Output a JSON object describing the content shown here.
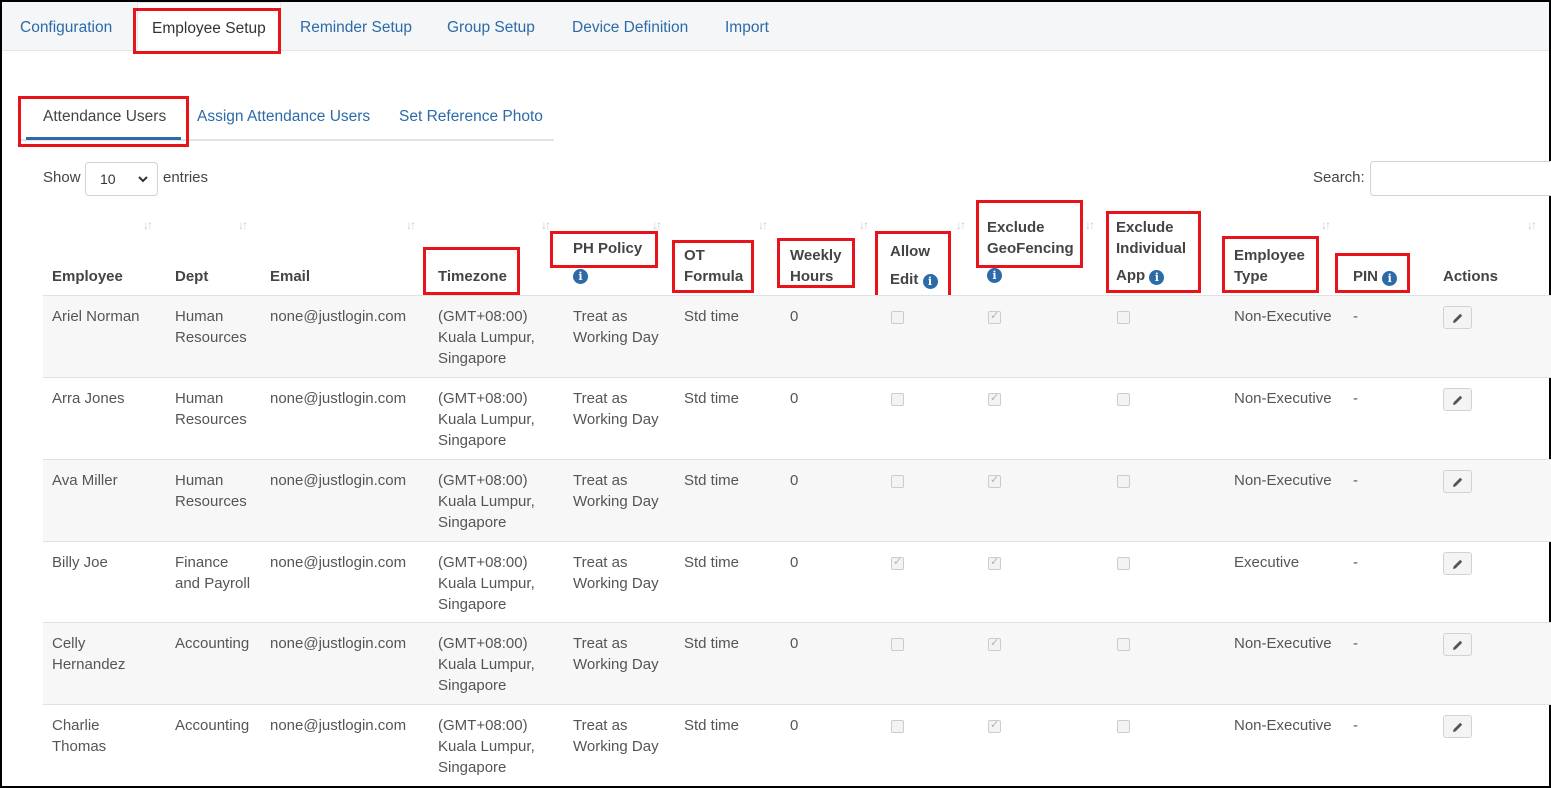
{
  "top_nav": {
    "tabs": [
      "Configuration",
      "Employee Setup",
      "Reminder Setup",
      "Group Setup",
      "Device Definition",
      "Import"
    ],
    "active": "Employee Setup"
  },
  "sub_nav": {
    "tabs": [
      "Attendance Users",
      "Assign Attendance Users",
      "Set Reference Photo"
    ],
    "active": "Attendance Users"
  },
  "length_control": {
    "show_label": "Show",
    "value": "10",
    "entries_label": "entries"
  },
  "search": {
    "label": "Search:",
    "value": ""
  },
  "table": {
    "headers": {
      "employee": "Employee",
      "dept": "Dept",
      "email": "Email",
      "timezone": "Timezone",
      "ph_policy": "PH Policy",
      "ot_formula_1": "OT",
      "ot_formula_2": "Formula",
      "weekly_hours_1": "Weekly",
      "weekly_hours_2": "Hours",
      "allow_edit_1": "Allow",
      "allow_edit_2": "Edit",
      "exclude_geo_1": "Exclude",
      "exclude_geo_2": "GeoFencing",
      "exclude_app_1": "Exclude",
      "exclude_app_2": "Individual",
      "exclude_app_3": "App",
      "employee_type_1": "Employee",
      "employee_type_2": "Type",
      "pin": "PIN",
      "actions": "Actions"
    },
    "rows": [
      {
        "employee": [
          "Ariel Norman"
        ],
        "dept": [
          "Human",
          "Resources"
        ],
        "email": "none@justlogin.com",
        "timezone": [
          "(GMT+08:00)",
          "Kuala Lumpur,",
          "Singapore"
        ],
        "ph_policy": [
          "Treat as",
          "Working Day"
        ],
        "ot_formula": "Std time",
        "weekly_hours": "0",
        "allow_edit": false,
        "exclude_geofencing": true,
        "exclude_individual_app": false,
        "employee_type": "Non-Executive",
        "pin": "-"
      },
      {
        "employee": [
          "Arra Jones"
        ],
        "dept": [
          "Human",
          "Resources"
        ],
        "email": "none@justlogin.com",
        "timezone": [
          "(GMT+08:00)",
          "Kuala Lumpur,",
          "Singapore"
        ],
        "ph_policy": [
          "Treat as",
          "Working Day"
        ],
        "ot_formula": "Std time",
        "weekly_hours": "0",
        "allow_edit": false,
        "exclude_geofencing": true,
        "exclude_individual_app": false,
        "employee_type": "Non-Executive",
        "pin": "-"
      },
      {
        "employee": [
          "Ava Miller"
        ],
        "dept": [
          "Human",
          "Resources"
        ],
        "email": "none@justlogin.com",
        "timezone": [
          "(GMT+08:00)",
          "Kuala Lumpur,",
          "Singapore"
        ],
        "ph_policy": [
          "Treat as",
          "Working Day"
        ],
        "ot_formula": "Std time",
        "weekly_hours": "0",
        "allow_edit": false,
        "exclude_geofencing": true,
        "exclude_individual_app": false,
        "employee_type": "Non-Executive",
        "pin": "-"
      },
      {
        "employee": [
          "Billy Joe"
        ],
        "dept": [
          "Finance",
          "and Payroll"
        ],
        "email": "none@justlogin.com",
        "timezone": [
          "(GMT+08:00)",
          "Kuala Lumpur,",
          "Singapore"
        ],
        "ph_policy": [
          "Treat as",
          "Working Day"
        ],
        "ot_formula": "Std time",
        "weekly_hours": "0",
        "allow_edit": true,
        "exclude_geofencing": true,
        "exclude_individual_app": false,
        "employee_type": "Executive",
        "pin": "-"
      },
      {
        "employee": [
          "Celly",
          "Hernandez"
        ],
        "dept": [
          "Accounting"
        ],
        "email": "none@justlogin.com",
        "timezone": [
          "(GMT+08:00)",
          "Kuala Lumpur,",
          "Singapore"
        ],
        "ph_policy": [
          "Treat as",
          "Working Day"
        ],
        "ot_formula": "Std time",
        "weekly_hours": "0",
        "allow_edit": false,
        "exclude_geofencing": true,
        "exclude_individual_app": false,
        "employee_type": "Non-Executive",
        "pin": "-"
      },
      {
        "employee": [
          "Charlie",
          "Thomas"
        ],
        "dept": [
          "Accounting"
        ],
        "email": "none@justlogin.com",
        "timezone": [
          "(GMT+08:00)",
          "Kuala Lumpur,",
          "Singapore"
        ],
        "ph_policy": [
          "Treat as",
          "Working Day"
        ],
        "ot_formula": "Std time",
        "weekly_hours": "0",
        "allow_edit": false,
        "exclude_geofencing": true,
        "exclude_individual_app": false,
        "employee_type": "Non-Executive",
        "pin": "-"
      }
    ]
  },
  "icons": {
    "sort": "sort-icon",
    "info": "info-icon",
    "edit": "pencil-icon",
    "dropdown": "chevron-down-icon"
  },
  "colors": {
    "link": "#2c6aa8",
    "highlight_box": "#e8141c",
    "row_stripe": "#f7f7f7"
  }
}
